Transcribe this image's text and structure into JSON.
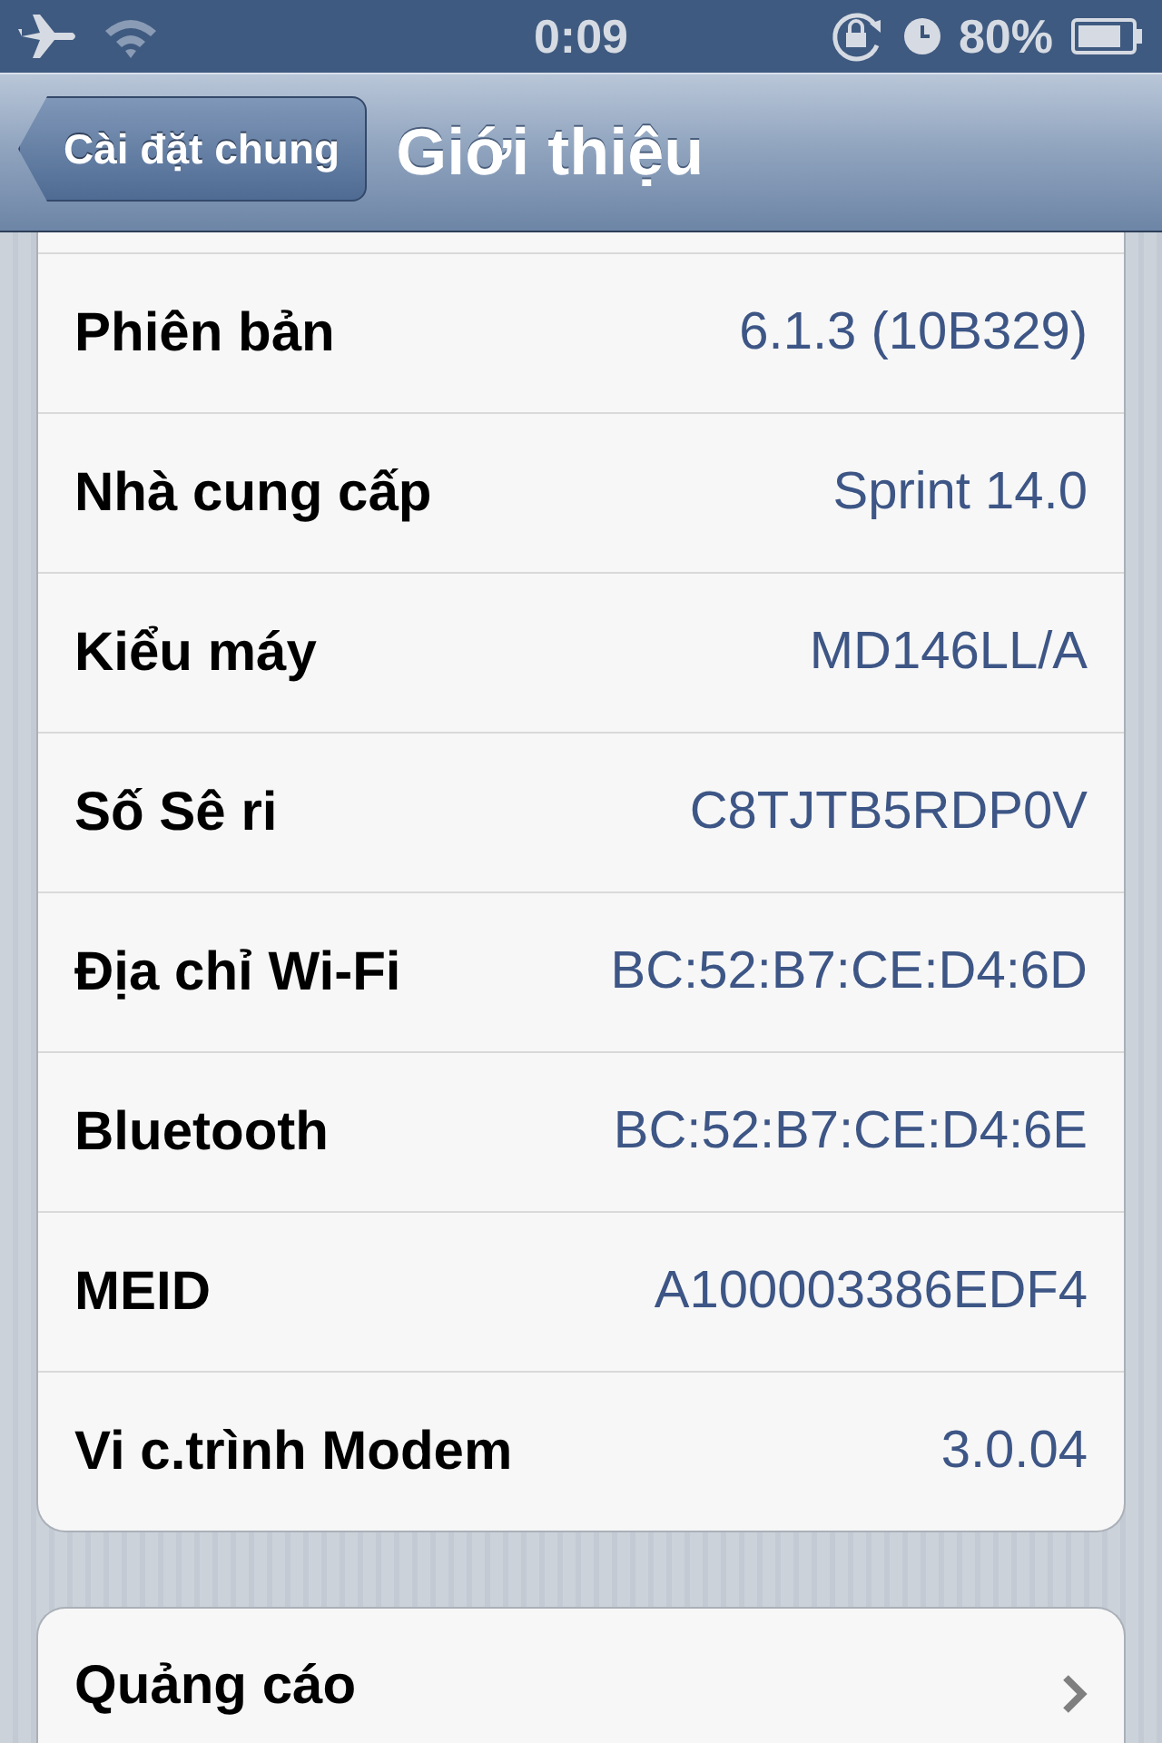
{
  "status_bar": {
    "time": "0:09",
    "battery_percent": "80%"
  },
  "nav_bar": {
    "back_button": "Cài đặt chung",
    "title": "Giới thiệu"
  },
  "info_rows": [
    {
      "label": "Phiên bản",
      "value": "6.1.3 (10B329)"
    },
    {
      "label": "Nhà cung cấp",
      "value": "Sprint 14.0"
    },
    {
      "label": "Kiểu máy",
      "value": "MD146LL/A"
    },
    {
      "label": "Số Sê ri",
      "value": "C8TJTB5RDP0V"
    },
    {
      "label": "Địa chỉ Wi-Fi",
      "value": "BC:52:B7:CE:D4:6D"
    },
    {
      "label": "Bluetooth",
      "value": "BC:52:B7:CE:D4:6E"
    },
    {
      "label": "MEID",
      "value": "A100003386EDF4"
    },
    {
      "label": "Vi c.trình Modem",
      "value": "3.0.04"
    }
  ],
  "link_rows": [
    {
      "label": "Quảng cáo"
    }
  ]
}
